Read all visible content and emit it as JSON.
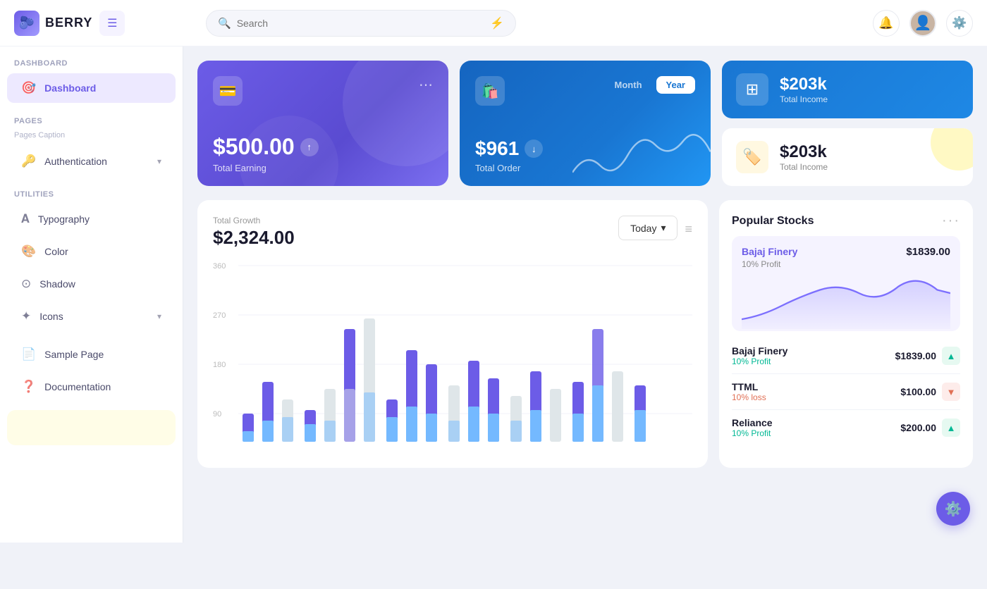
{
  "app": {
    "name": "BERRY"
  },
  "topbar": {
    "hamburger_label": "☰",
    "search_placeholder": "Search",
    "bell_icon": "🔔",
    "settings_icon": "⚙️"
  },
  "sidebar": {
    "dashboard_section": "Dashboard",
    "dashboard_item": "Dashboard",
    "pages_section": "Pages",
    "pages_caption": "Pages Caption",
    "auth_item": "Authentication",
    "utilities_section": "Utilities",
    "typography_item": "Typography",
    "color_item": "Color",
    "shadow_item": "Shadow",
    "icons_item": "Icons",
    "sample_page_item": "Sample Page",
    "documentation_item": "Documentation"
  },
  "cards": {
    "earning_amount": "$500.00",
    "earning_label": "Total Earning",
    "order_amount": "$961",
    "order_label": "Total Order",
    "month_tab": "Month",
    "year_tab": "Year",
    "income_top_amount": "$203k",
    "income_top_label": "Total Income",
    "income_bottom_amount": "$203k",
    "income_bottom_label": "Total Income"
  },
  "chart": {
    "title": "Total Growth",
    "amount": "$2,324.00",
    "filter_btn": "Today",
    "y_labels": [
      "360",
      "270",
      "180",
      "90"
    ],
    "menu_icon": "≡"
  },
  "stocks": {
    "title": "Popular Stocks",
    "menu": "···",
    "featured_name": "Bajaj Finery",
    "featured_price": "$1839.00",
    "featured_profit": "10% Profit",
    "items": [
      {
        "name": "Bajaj Finery",
        "price": "$1839.00",
        "profit": "10% Profit",
        "trend": "up"
      },
      {
        "name": "TTML",
        "price": "$100.00",
        "profit": "10% loss",
        "trend": "down"
      },
      {
        "name": "Reliance",
        "price": "$200.00",
        "profit": "10% Profit",
        "trend": "up"
      }
    ]
  },
  "fab": {
    "icon": "⚙️"
  }
}
